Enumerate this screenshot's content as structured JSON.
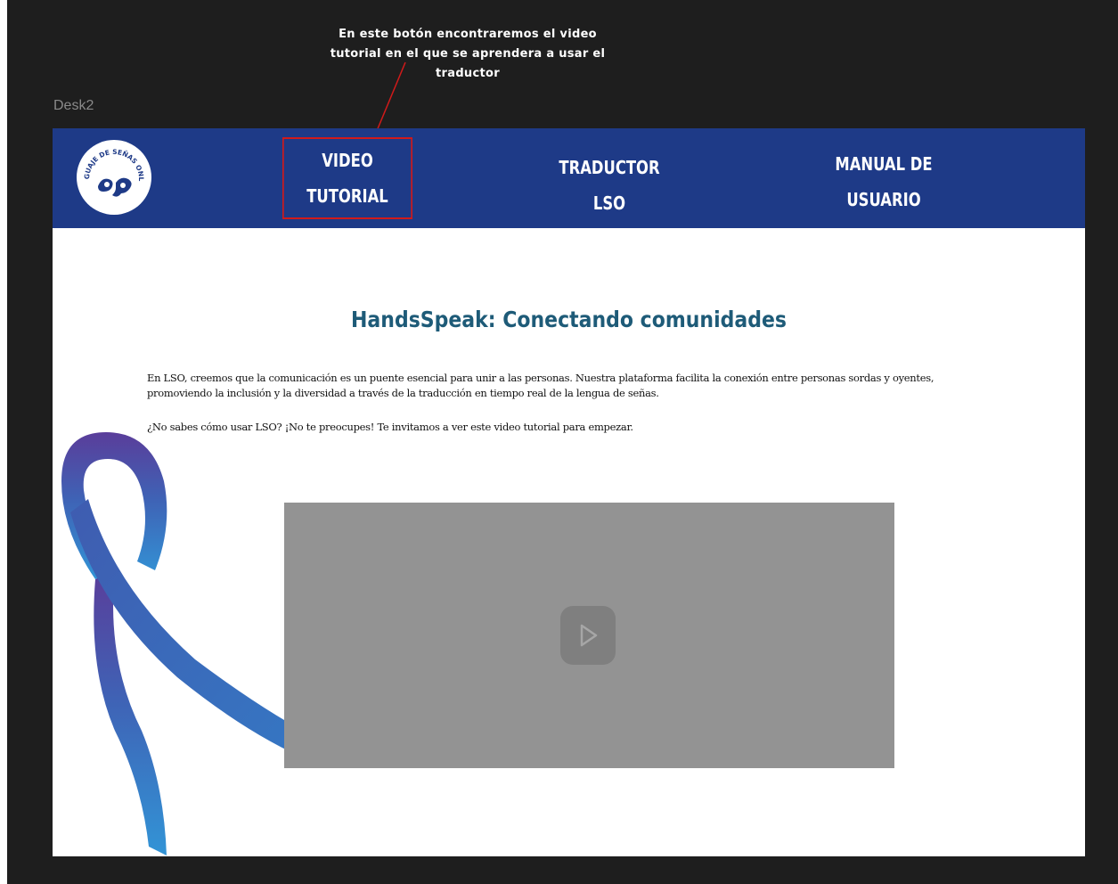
{
  "annotation": {
    "text_line1": "En este botón encontraremos el video",
    "text_line2": "tutorial en el que se aprendera a usar el",
    "text_line3": "traductor"
  },
  "frame": {
    "label": "Desk2"
  },
  "navbar": {
    "logo": {
      "icon": "sign-language-logo-icon",
      "text": "LENGUAJE DE SEÑAS ONLINE"
    },
    "items": [
      {
        "line1": "VIDEO",
        "line2": "TUTORIAL"
      },
      {
        "line1": "TRADUCTOR",
        "line2": "LSO"
      },
      {
        "line1": "MANUAL DE",
        "line2": "USUARIO"
      }
    ]
  },
  "main": {
    "title": "HandsSpeak: Conectando comunidades",
    "paragraph1_line1": "En LSO, creemos que la comunicación es un puente esencial para unir a las personas. Nuestra plataforma facilita la conexión entre personas sordas y oyentes,",
    "paragraph1_line2": "promoviendo la inclusión y la diversidad a través de la traducción en tiempo real de la lengua de señas.",
    "paragraph2": "¿No sabes cómo usar LSO? ¡No te preocupes! Te invitamos a ver este video tutorial para empezar.",
    "video": {
      "icon": "play-icon"
    },
    "ribbon": {
      "icon": "awareness-ribbon-icon"
    }
  },
  "colors": {
    "navbar": "#1e3a87",
    "title": "#1e5b78",
    "highlight": "#d11a1a",
    "video_bg": "#939393",
    "canvas": "#1e1e1e"
  }
}
